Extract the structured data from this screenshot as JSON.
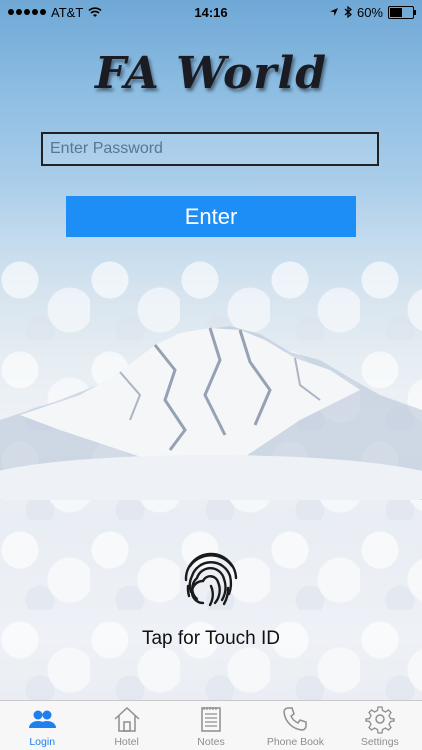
{
  "status_bar": {
    "carrier": "AT&T",
    "time": "14:16",
    "battery": "60%",
    "battery_level": 0.6,
    "signal_bars": 5
  },
  "app": {
    "title": "FA World"
  },
  "login": {
    "password_placeholder": "Enter Password",
    "password_value": "",
    "enter_label": "Enter",
    "touch_id_label": "Tap for Touch ID"
  },
  "tabs": [
    {
      "label": "Login",
      "icon": "users-icon",
      "active": true
    },
    {
      "label": "Hotel",
      "icon": "house-icon",
      "active": false
    },
    {
      "label": "Notes",
      "icon": "notepad-icon",
      "active": false
    },
    {
      "label": "Phone Book",
      "icon": "phone-icon",
      "active": false
    },
    {
      "label": "Settings",
      "icon": "gear-icon",
      "active": false
    }
  ],
  "colors": {
    "accent": "#1e8ef7",
    "tab_active": "#1e7ff0",
    "tab_inactive": "#8e8e93"
  }
}
